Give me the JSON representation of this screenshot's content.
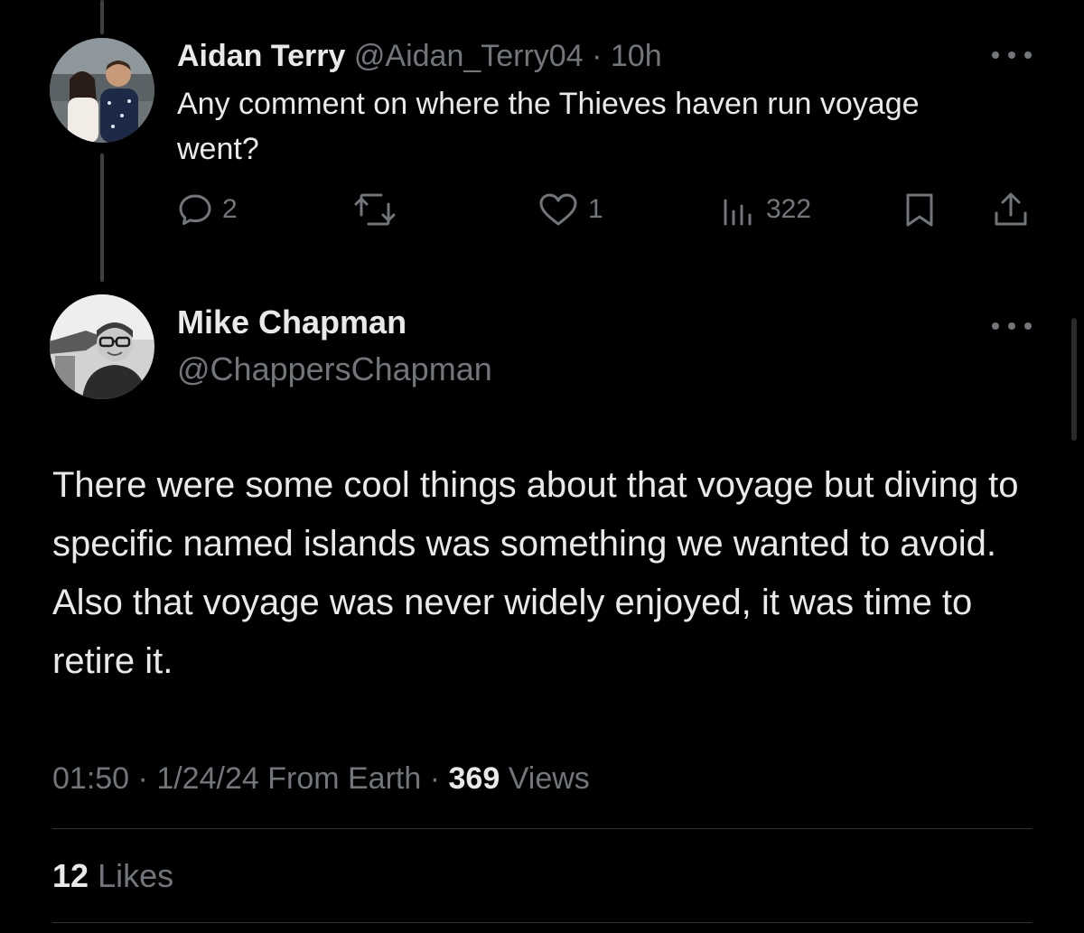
{
  "reply": {
    "name": "Aidan Terry",
    "handle": "@Aidan_Terry04",
    "separator": "·",
    "time": "10h",
    "text": "Any comment on where the Thieves haven run voyage went?",
    "actions": {
      "replies": "2",
      "retweets": "",
      "likes": "1",
      "views": "322"
    }
  },
  "main": {
    "name": "Mike Chapman",
    "handle": "@ChappersChapman",
    "text": "There were some cool things about that voyage but diving to specific named islands was something we wanted to avoid. Also that voyage was never widely enjoyed, it was time to retire it.",
    "time": "01:50",
    "date": "1/24/24",
    "source": "From Earth",
    "separator": "·",
    "views_count": "369",
    "views_label": "Views",
    "likes_count": "12",
    "likes_label": "Likes"
  },
  "colors": {
    "background": "#000000",
    "text": "#e7e9ea",
    "muted": "#71767b",
    "divider": "#2f3336",
    "thread_line": "#3e4144"
  },
  "icons": {
    "reply_avatar": "avatar-photo",
    "main_avatar": "avatar-photo",
    "more": "more-horizontal-icon",
    "reply": "comment-icon",
    "retweet": "retweet-icon",
    "like": "heart-icon",
    "views": "analytics-icon",
    "bookmark": "bookmark-icon",
    "share": "share-icon"
  }
}
